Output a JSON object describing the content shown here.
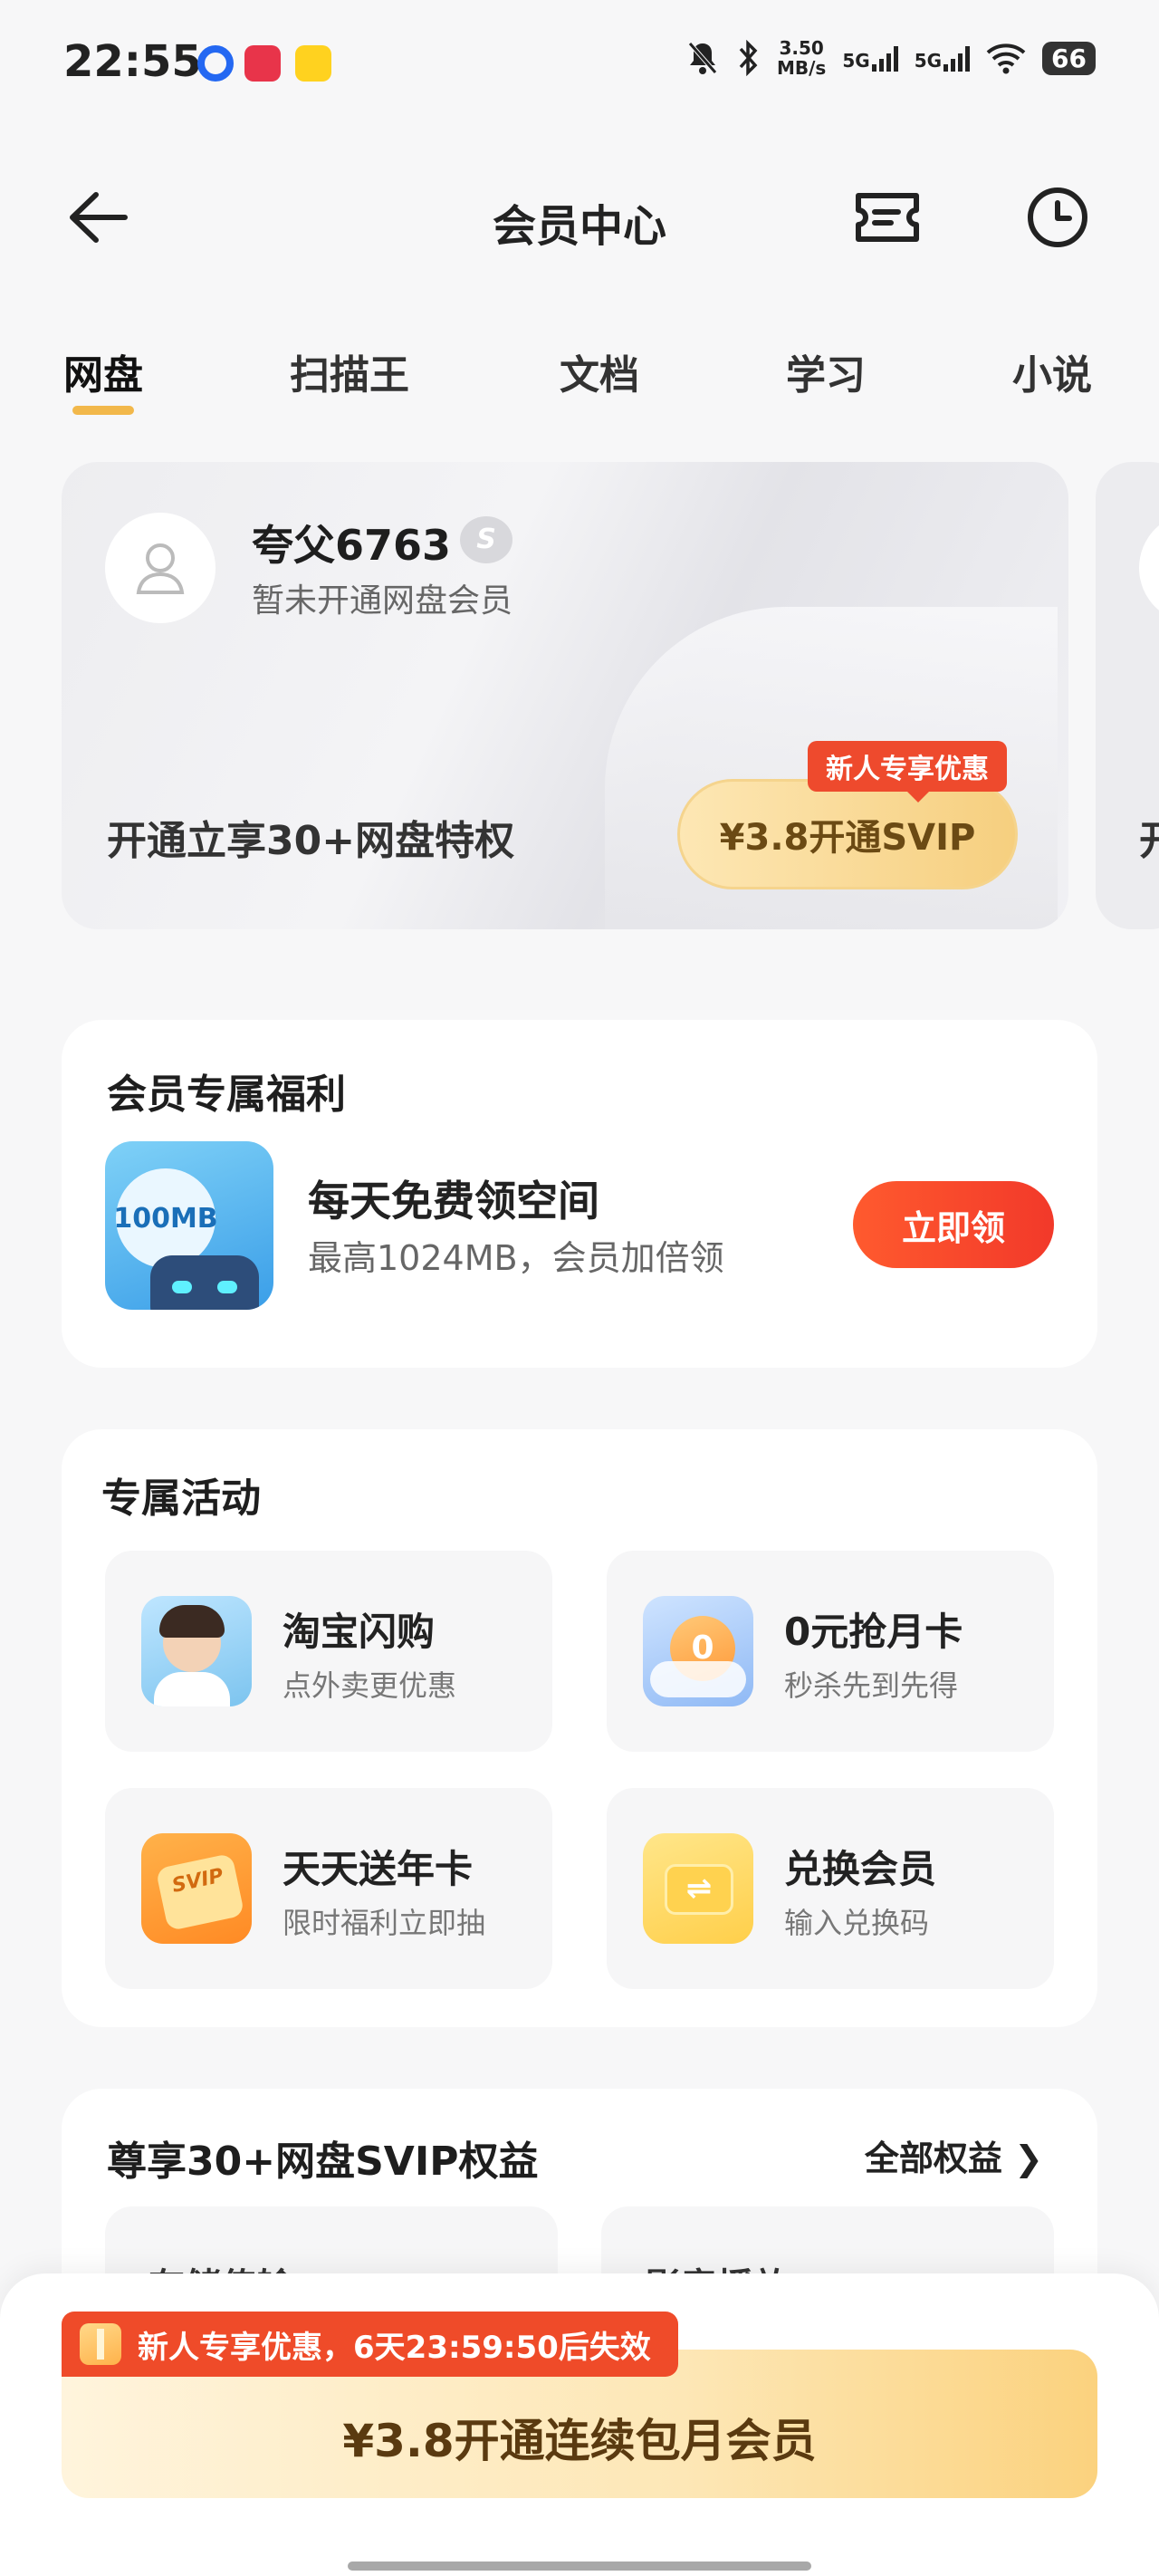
{
  "status_bar": {
    "time": "22:55",
    "net_speed_value": "3.50",
    "net_speed_unit": "MB/s",
    "signal_1": "5G",
    "signal_2": "5G",
    "battery": "66",
    "icons": [
      "notification-app-icon",
      "shopping-app-icon",
      "meituan-app-icon",
      "mute-bell-icon",
      "bluetooth-icon",
      "wifi-icon"
    ]
  },
  "header": {
    "title": "会员中心"
  },
  "tabs": [
    {
      "label": "网盘",
      "active": true
    },
    {
      "label": "扫描王",
      "active": false
    },
    {
      "label": "文档",
      "active": false
    },
    {
      "label": "学习",
      "active": false
    },
    {
      "label": "小说",
      "active": false
    }
  ],
  "member_card": {
    "username": "夸父6763",
    "status": "暂未开通网盘会员",
    "promo_text": "开通立享30+网盘特权",
    "new_user_tag": "新人专享优惠",
    "svip_button_label": "¥3.8开通SVIP",
    "peek_text": "开"
  },
  "benefits": {
    "title": "会员专属福利",
    "icon_label": "100MB",
    "item_name": "每天免费领空间",
    "item_desc": "最高1024MB，会员加倍领",
    "claim_label": "立即领"
  },
  "activities": {
    "title": "专属活动",
    "items": [
      {
        "name": "淘宝闪购",
        "desc": "点外卖更优惠"
      },
      {
        "name": "0元抢月卡",
        "desc": "秒杀先到先得"
      },
      {
        "name": "天天送年卡",
        "desc": "限时福利立即抽"
      },
      {
        "name": "兑换会员",
        "desc": "输入兑换码"
      }
    ]
  },
  "rights": {
    "title": "尊享30+网盘SVIP权益",
    "all_link": "全部权益 ❯",
    "tiles": [
      "存储传输",
      "影音播放"
    ]
  },
  "bottom": {
    "countdown": "新人专享优惠，6天23:59:50后失效",
    "cta_label": "¥3.8开通连续包月会员"
  },
  "colors": {
    "accent_orange": "#ee4a2d",
    "gold": "#f6cf7f",
    "background": "#f7f7f8"
  }
}
